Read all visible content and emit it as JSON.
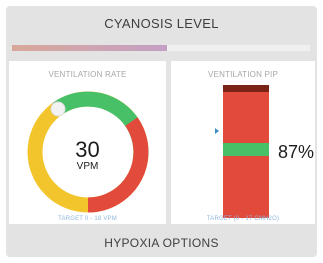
{
  "header": {
    "title": "CYANOSIS LEVEL"
  },
  "cyanosis_bar": {
    "level_percent": 52
  },
  "ventilation_rate": {
    "title": "VENTILATION RATE",
    "value": "30",
    "unit": "VPM",
    "target_text": "TARGET 0 - 18 VPM"
  },
  "ventilation_pip": {
    "title": "VENTILATION PIP",
    "value": "87%",
    "target_text": "TARGET (0 - 17 cmH2O)"
  },
  "footer": {
    "label": "HYPOXIA OPTIONS"
  },
  "colors": {
    "green": "#47c067",
    "red": "#e24a3b",
    "yellow": "#f3c52c",
    "dark_red": "#7a2418",
    "pointer_blue": "#3d8fc4"
  }
}
